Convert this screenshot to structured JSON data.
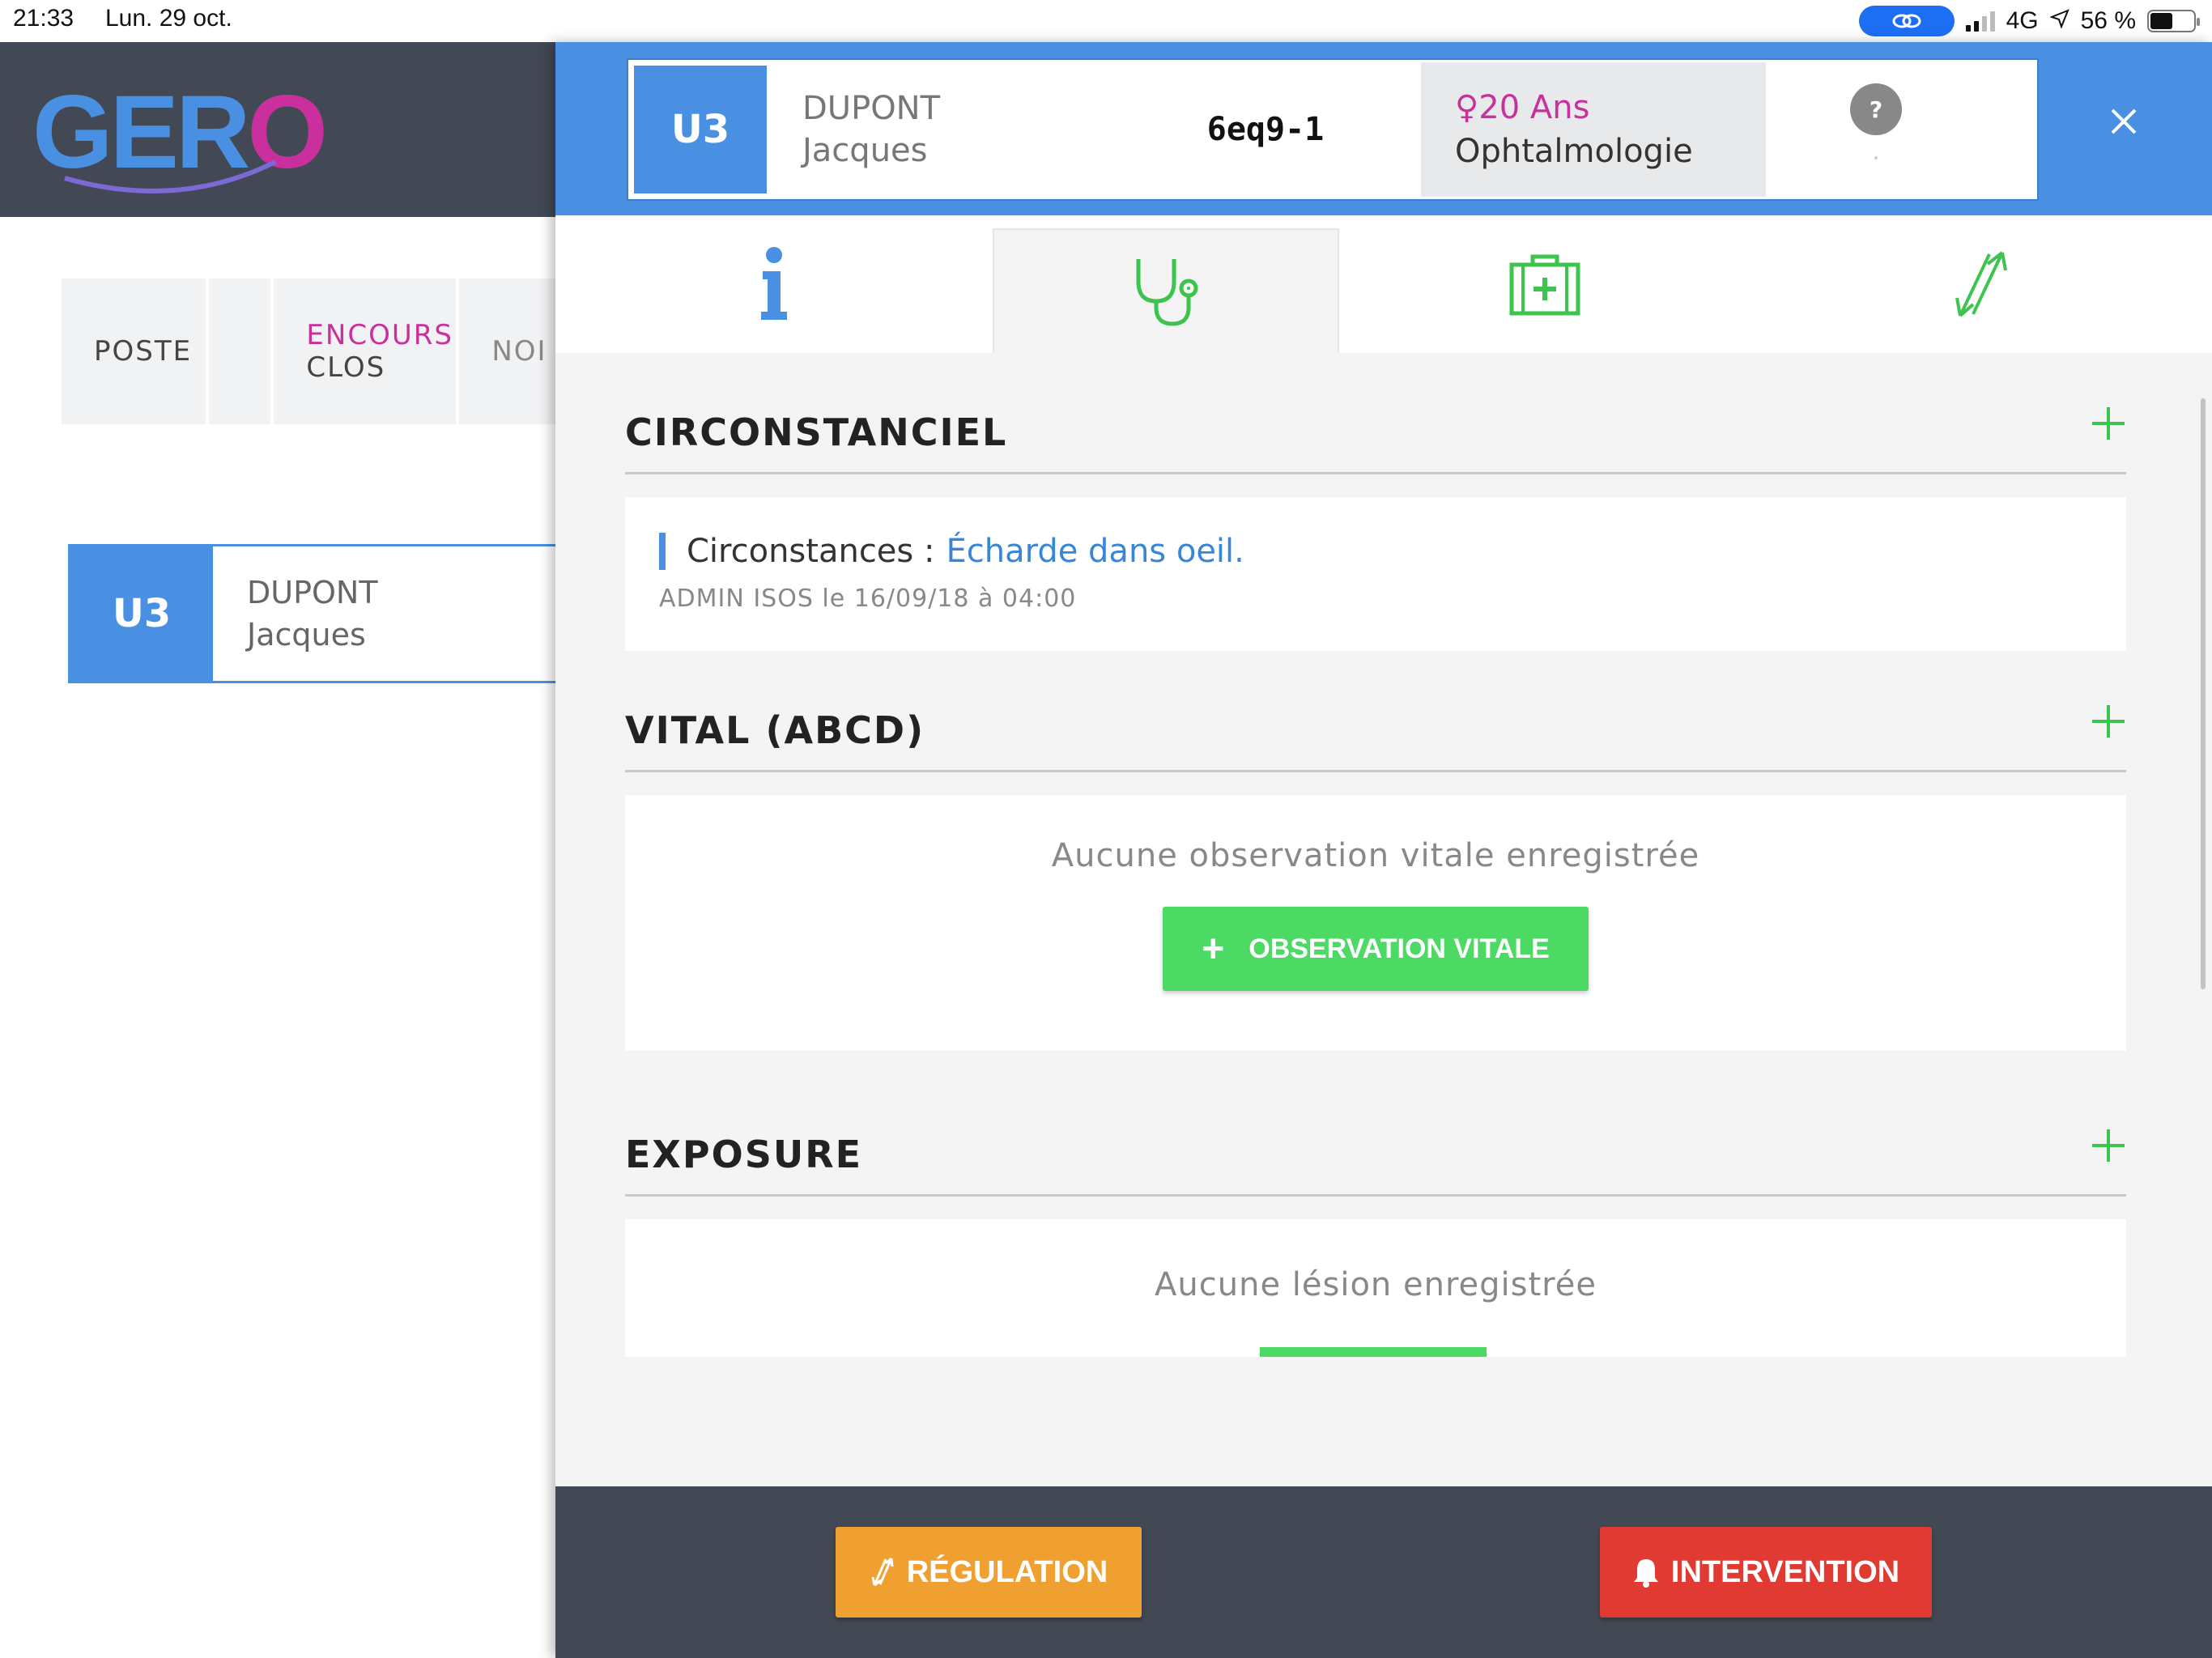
{
  "status_bar": {
    "time": "21:33",
    "date": "Lun. 29 oct.",
    "network": "4G",
    "battery": "56 %"
  },
  "left_app": {
    "logo": {
      "text_main": "GER",
      "text_o": "O"
    },
    "tabs": {
      "poste": "POSTE",
      "encours": "ENCOURS",
      "clos": "CLOS",
      "nom": "NOI"
    },
    "card": {
      "badge": "U3",
      "last_name": "DUPONT",
      "first_name": "Jacques"
    }
  },
  "patient": {
    "badge": "U3",
    "last_name": "DUPONT",
    "first_name": "Jacques",
    "code": "6eq9-1",
    "age": "♀20 Ans",
    "specialty": "Ophtalmologie",
    "help": "?"
  },
  "tabs": [
    {
      "icon": "info-icon"
    },
    {
      "icon": "stethoscope-icon",
      "active": true
    },
    {
      "icon": "medical-kit-icon"
    },
    {
      "icon": "transfer-arrows-icon"
    }
  ],
  "sections": {
    "circ": {
      "title": "CIRCONSTANCIEL",
      "label": "Circonstances :",
      "value": "Écharde dans oeil",
      "period": ".",
      "meta": "ADMIN ISOS le 16/09/18 à 04:00"
    },
    "vital": {
      "title": "VITAL (ABCD)",
      "empty": "Aucune observation vitale enregistrée",
      "button": "OBSERVATION VITALE"
    },
    "expo": {
      "title": "EXPOSURE",
      "empty": "Aucune lésion enregistrée"
    }
  },
  "footer": {
    "regulation": "RÉGULATION",
    "intervention": "INTERVENTION"
  },
  "colors": {
    "primary_blue": "#4a90e2",
    "magenta": "#c9309e",
    "green": "#4cd964",
    "orange": "#f0a030",
    "red": "#e03a33",
    "dark": "#424955"
  }
}
